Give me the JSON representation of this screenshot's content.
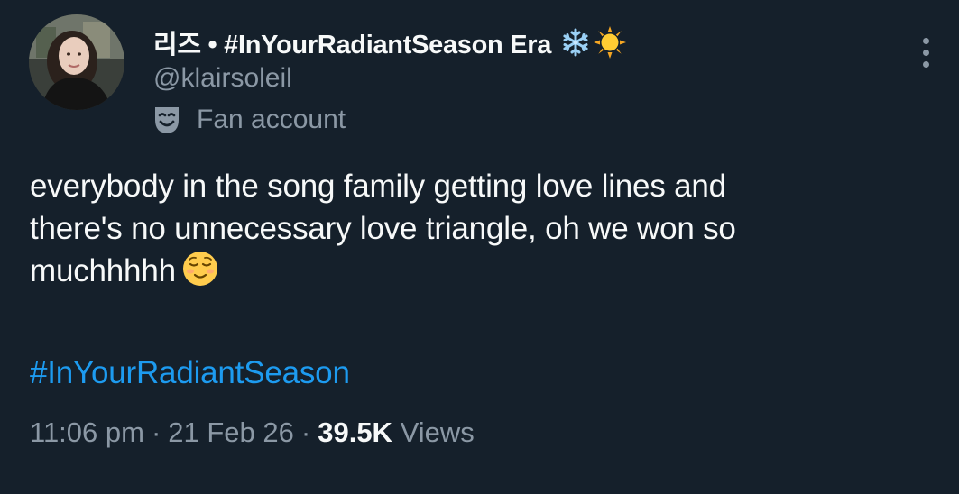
{
  "user": {
    "display_name": "리즈 • #InYourRadiantSeason Era",
    "name_emojis": [
      "snowflake-icon",
      "sun-icon"
    ],
    "handle": "@klairsoleil",
    "label_icon": "theater-mask-icon",
    "label": "Fan account"
  },
  "tweet": {
    "lines": [
      "everybody in the song family getting love lines and",
      "there's no unnecessary love triangle, oh we won so",
      "muchhhhh"
    ],
    "trailing_emoji": "relieved-face-emoji",
    "hashtag": "#InYourRadiantSeason"
  },
  "meta": {
    "time": "11:06 pm",
    "separator": "·",
    "date": "21 Feb 26",
    "views_count": "39.5K",
    "views_label": "Views"
  },
  "colors": {
    "background": "#15202b",
    "text_primary": "#f7f9f9",
    "text_secondary": "#8b98a5",
    "link": "#1d9bf0",
    "divider": "#38444d"
  }
}
